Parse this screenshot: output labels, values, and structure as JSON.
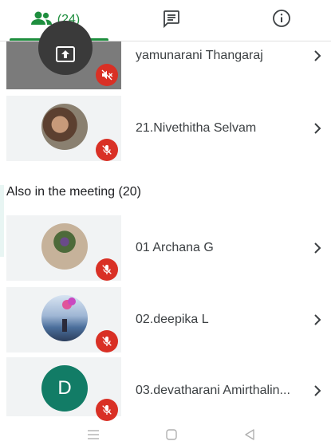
{
  "tabs": {
    "people_count": "(24)",
    "accent_color": "#1e8e3e"
  },
  "participants_top": [
    {
      "name": "yamunarani Thangaraj",
      "tile": "presenting",
      "muted": true
    },
    {
      "name": "21.Nivethitha Selvam",
      "tile": "photo",
      "muted": true
    }
  ],
  "section": {
    "title": "Also in the meeting (20)"
  },
  "participants": [
    {
      "name": "01 Archana G",
      "avatar": "photo",
      "muted": true
    },
    {
      "name": "02.deepika L",
      "avatar": "photo",
      "muted": true
    },
    {
      "name": "03.devatharani Amirthalin...",
      "avatar_letter": "D",
      "avatar_color": "#127c66",
      "muted": true
    }
  ],
  "colors": {
    "mute_badge": "#d93025",
    "tile_bg": "#f1f3f4"
  },
  "icons": [
    "people-icon",
    "chat-icon",
    "info-icon",
    "present-screen-icon",
    "mic-off-icon",
    "volume-off-icon",
    "chevron-right-icon",
    "nav-menu-icon",
    "nav-home-icon",
    "nav-back-icon"
  ]
}
